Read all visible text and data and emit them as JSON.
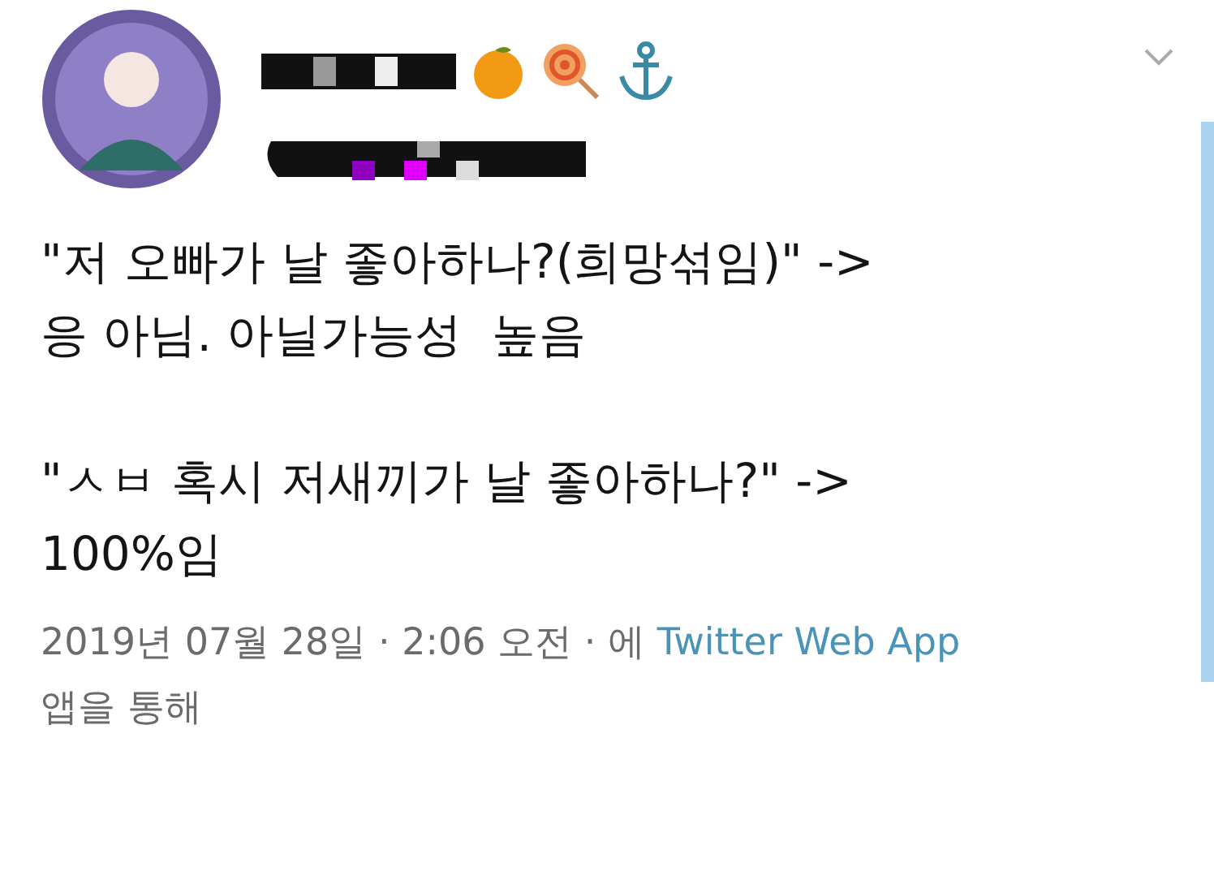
{
  "tweet": {
    "author": {
      "redacted": true
    },
    "body": [
      {
        "lines": [
          "\"저 오빠가 날 좋아하나?(희망섞임)\" ->",
          "응 아님. 아닐가능성  높음"
        ]
      },
      {
        "lines": [
          "\"ㅅㅂ 혹시 저새끼가 날 좋아하나?\" ->",
          "100%임"
        ]
      }
    ],
    "meta": {
      "timestamp": "2019년 07월 28일 · 2:06 오전 · 에",
      "via": "Twitter Web App",
      "suffix": "앱을 통해"
    }
  }
}
